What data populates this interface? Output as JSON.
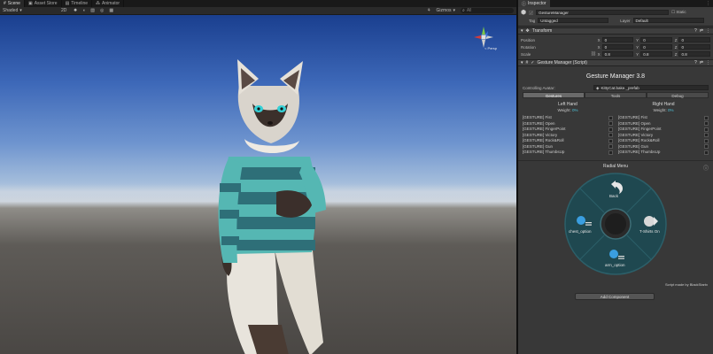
{
  "scene_tabs": [
    {
      "label": "Scene",
      "icon": "scene-icon"
    },
    {
      "label": "Asset Store",
      "icon": "asset-store-icon"
    },
    {
      "label": "Timeline",
      "icon": "timeline-icon"
    },
    {
      "label": "Animator",
      "icon": "animator-icon"
    }
  ],
  "toolbar": {
    "shading_mode": "Shaded",
    "mode_2d": "2D",
    "gizmos": "Gizmos",
    "search_placeholder": "All"
  },
  "scene": {
    "persp_label": "< Persp"
  },
  "inspector": {
    "tab_label": "Inspector",
    "object_name": "GestureManager",
    "static_label": "Static",
    "tag_label": "Tag",
    "tag_value": "Untagged",
    "layer_label": "Layer",
    "layer_value": "Default",
    "transform": {
      "title": "Transform",
      "rows": [
        {
          "label": "Position",
          "x": "0",
          "y": "0",
          "z": "0"
        },
        {
          "label": "Rotation",
          "x": "0",
          "y": "0",
          "z": "0"
        },
        {
          "label": "Scale",
          "x": "0.8",
          "y": "0.8",
          "z": "0.8"
        }
      ]
    },
    "script": {
      "title": "Gesture Manager (Script)",
      "heading": "Gesture Manager 3.8",
      "controlling_label": "Controlling Avatar:",
      "controlling_value": "KittyCat.bake._prefab",
      "tabs": [
        "Gestures",
        "Tools",
        "Debug"
      ],
      "selected_tab": "Gestures",
      "left_hand": {
        "title": "Left Hand",
        "weight_label": "Weight:",
        "weight_value": "0%",
        "gestures": [
          "[GESTURE] Fist",
          "[GESTURE] Open",
          "[GESTURE] FingerPoint",
          "[GESTURE] Victory",
          "[GESTURE] Rock&Roll",
          "[GESTURE] Gun",
          "[GESTURE] ThumbsUp"
        ]
      },
      "right_hand": {
        "title": "Right Hand",
        "weight_label": "Weight:",
        "weight_value": "0%",
        "gestures": [
          "[GESTURE] Fist",
          "[GESTURE] Open",
          "[GESTURE] FingerPoint",
          "[GESTURE] Victory",
          "[GESTURE] Rock&Roll",
          "[GESTURE] Gun",
          "[GESTURE] ThumbsUp"
        ]
      },
      "radial_menu": {
        "title": "Radial Menu",
        "items": [
          {
            "label": "Back",
            "icon": "back-arrow-icon"
          },
          {
            "label": "T-Shirts On",
            "icon": "shirt-toggle-icon"
          },
          {
            "label": "arm_option",
            "icon": "gear-list-icon"
          },
          {
            "label": "chest_option",
            "icon": "gear-list-icon"
          }
        ]
      },
      "credit": "Script made by BlackStartx"
    },
    "add_component": "Add Component"
  },
  "colors": {
    "accent": "#4a9ad6",
    "weight": "#4fc3d8",
    "radial_bg": "#1f4850",
    "radial_ring": "#2c5f69"
  }
}
